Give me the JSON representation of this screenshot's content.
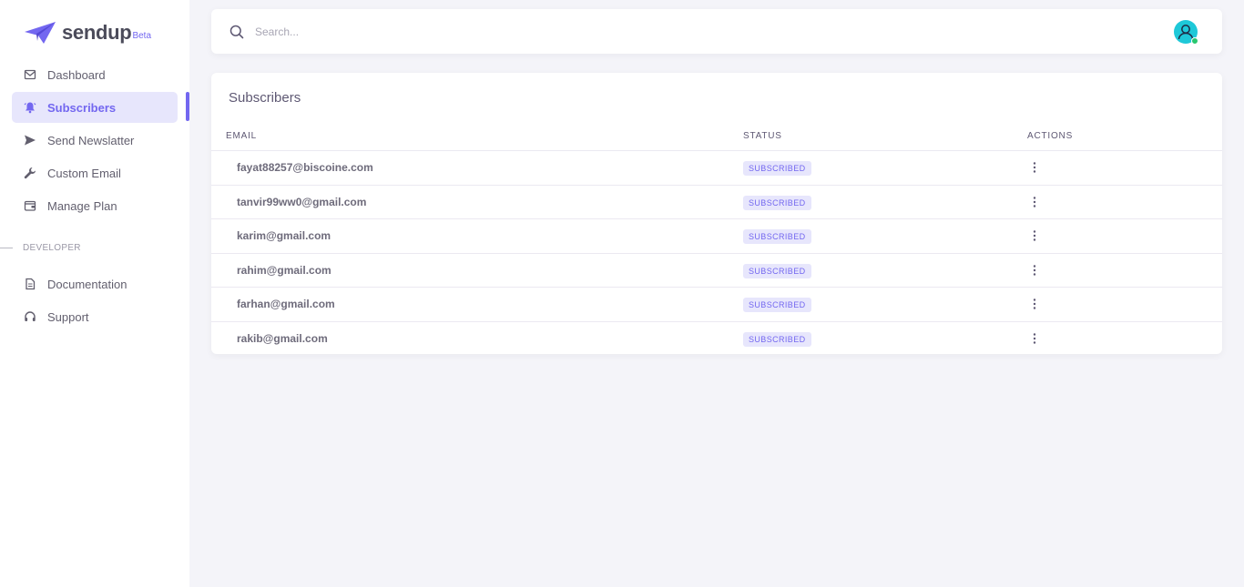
{
  "brand": {
    "name": "sendup",
    "tag": "Beta"
  },
  "colors": {
    "accent": "#7367f0",
    "badge_bg": "#e7e6fc",
    "avatar": "#1ec8d8",
    "online": "#28c76f"
  },
  "sidebar": {
    "items": [
      {
        "label": "Dashboard",
        "icon": "mail-icon"
      },
      {
        "label": "Subscribers",
        "icon": "bell-icon",
        "active": true
      },
      {
        "label": "Send Newslatter",
        "icon": "send-icon"
      },
      {
        "label": "Custom Email",
        "icon": "wrench-icon"
      },
      {
        "label": "Manage Plan",
        "icon": "wallet-icon"
      }
    ],
    "section": "DEVELOPER",
    "dev_items": [
      {
        "label": "Documentation",
        "icon": "file-icon"
      },
      {
        "label": "Support",
        "icon": "headphones-icon"
      }
    ]
  },
  "search": {
    "placeholder": "Search...",
    "value": ""
  },
  "card": {
    "title": "Subscribers",
    "columns": [
      "EMAIL",
      "STATUS",
      "ACTIONS"
    ],
    "rows": [
      {
        "email": "fayat88257@biscoine.com",
        "status": "SUBSCRIBED"
      },
      {
        "email": "tanvir99ww0@gmail.com",
        "status": "SUBSCRIBED"
      },
      {
        "email": "karim@gmail.com",
        "status": "SUBSCRIBED"
      },
      {
        "email": "rahim@gmail.com",
        "status": "SUBSCRIBED"
      },
      {
        "email": "farhan@gmail.com",
        "status": "SUBSCRIBED"
      },
      {
        "email": "rakib@gmail.com",
        "status": "SUBSCRIBED"
      }
    ]
  }
}
